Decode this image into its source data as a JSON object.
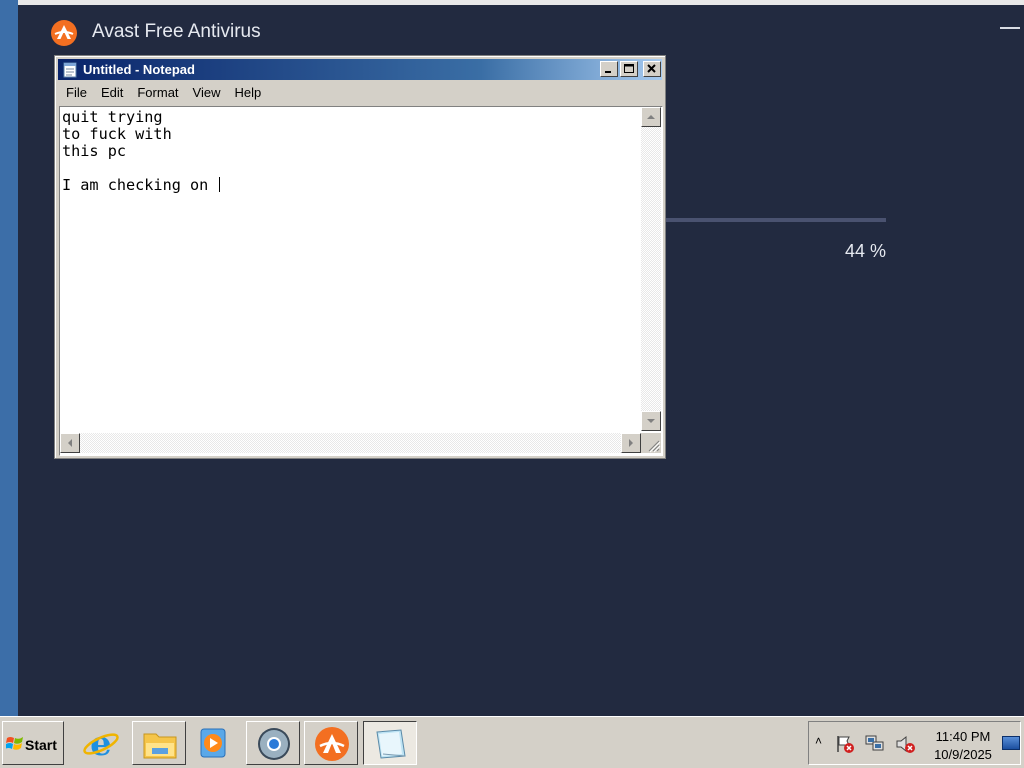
{
  "avast": {
    "title": "Avast Free Antivirus",
    "progress_text": "44 %",
    "progress_percent": 44,
    "colors": {
      "background": "#222a40",
      "accent": "#f36f21"
    }
  },
  "notepad": {
    "title": "Untitled - Notepad",
    "menu": [
      "File",
      "Edit",
      "Format",
      "View",
      "Help"
    ],
    "content": "quit trying\nto fuck with\nthis pc\n\nI am checking on "
  },
  "taskbar": {
    "start_label": "Start",
    "apps": [
      {
        "name": "internet-explorer-icon"
      },
      {
        "name": "windows-explorer-icon"
      },
      {
        "name": "media-player-icon"
      },
      {
        "name": "chrome-icon"
      },
      {
        "name": "avast-icon"
      },
      {
        "name": "notepad-icon",
        "active": true
      }
    ],
    "tray": {
      "chevron": "˄",
      "time": "11:40 PM",
      "date": "10/9/2025"
    }
  }
}
